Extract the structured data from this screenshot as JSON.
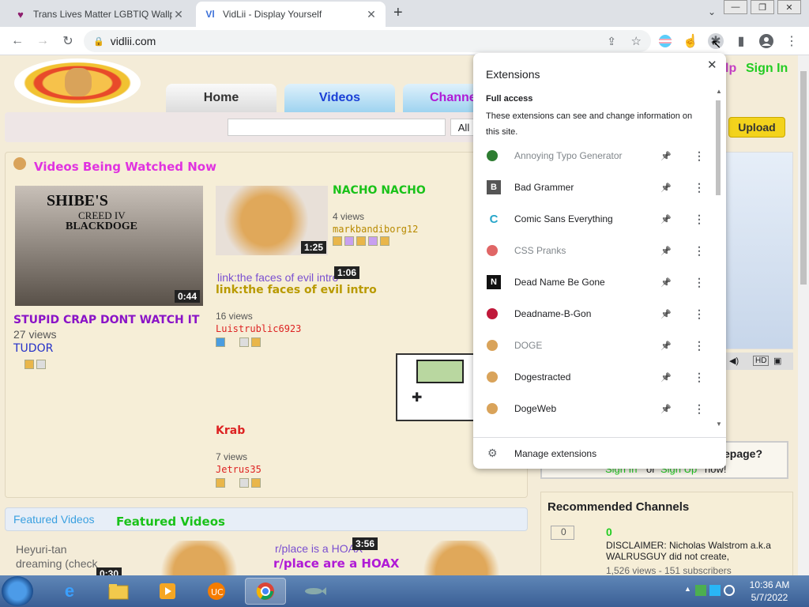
{
  "browser": {
    "tabs": [
      {
        "title": "Trans Lives Matter LGBTIQ Wallpe",
        "icon": "heart-icon",
        "active": false
      },
      {
        "title": "VidLii - Display Yourself",
        "icon": "vidlii-icon",
        "active": true
      }
    ],
    "url": "vidlii.com",
    "new_tab": "+"
  },
  "site": {
    "nav_tabs": [
      "Home",
      "Videos",
      "Channe"
    ],
    "search_scope": "All",
    "top_links": {
      "help_partial": "lp",
      "sign_in": "Sign In"
    },
    "upload_label": "Upload",
    "being_watched_title": "Videos Being Watched Now",
    "videos": [
      {
        "title": "STUPID CRAP DONT WATCH IT",
        "views": "27 views",
        "user": "TUDOR",
        "duration": "0:44",
        "thumb_text_1": "SHIBE'S",
        "thumb_text_2": "CREED IV",
        "thumb_text_3": "BLACKDOGE"
      },
      {
        "title": "NACHO NACHO",
        "views": "4 views",
        "user": "markbandiborg12",
        "duration": "1:25"
      },
      {
        "title": "link:the faces of evil intro",
        "alt": "link:the faces of evil intro",
        "views": "16 views",
        "user": "Luistrublic6923",
        "duration": "1:06"
      },
      {
        "title": "Krab",
        "views": "7 views",
        "user": "Jetrus35"
      }
    ],
    "featured_title": "Featured Videos",
    "featured_alt": "Featured Videos",
    "featured": [
      {
        "title": "Heyuri-tan dreaming (check",
        "duration": "0:30"
      },
      {
        "title": "r/place are a HOAX",
        "alt": "r/place is a HOAX",
        "duration": "3:56"
      }
    ],
    "homepage_box": {
      "q": "epage?",
      "sign_in": "Sign In",
      "or": "or",
      "sign_up": "Sign Up",
      "now": "now!"
    },
    "recommended_title": "Recommended Channels",
    "recommended": [
      {
        "name": "0",
        "alt": "0",
        "desc": "DISCLAIMER: Nicholas Walstrom a.k.a WALRUSGUY did not create,",
        "stats": "1,526 views - 151 subscribers"
      }
    ]
  },
  "extensions_popup": {
    "title": "Extensions",
    "full_access": "Full access",
    "full_access_desc": "These extensions can see and change information on this site.",
    "items": [
      {
        "name": "Annoying Typo Generator",
        "icon": "typo-icon",
        "color": "#2e7d32",
        "glyph": "",
        "muted": true
      },
      {
        "name": "Bad Grammer",
        "icon": "b-icon",
        "color": "#555555",
        "glyph": "B",
        "muted": false
      },
      {
        "name": "Comic Sans Everything",
        "icon": "c-icon",
        "color": "#26a5c9",
        "glyph": "C",
        "muted": false
      },
      {
        "name": "CSS Pranks",
        "icon": "css-pranks-icon",
        "color": "#e06666",
        "glyph": "",
        "muted": true
      },
      {
        "name": "Dead Name Be Gone",
        "icon": "n-icon",
        "color": "#111111",
        "glyph": "N",
        "muted": false
      },
      {
        "name": "Deadname-B-Gon",
        "icon": "skull-icon",
        "color": "#c0183a",
        "glyph": "",
        "muted": false
      },
      {
        "name": "DOGE",
        "icon": "doge-icon",
        "color": "#d9a35a",
        "glyph": "",
        "muted": true
      },
      {
        "name": "Dogestracted",
        "icon": "doge-icon",
        "color": "#d9a35a",
        "glyph": "",
        "muted": false
      },
      {
        "name": "DogeWeb",
        "icon": "doge-icon",
        "color": "#d9a35a",
        "glyph": "",
        "muted": false
      }
    ],
    "manage": "Manage extensions"
  },
  "taskbar": {
    "time": "10:36 AM",
    "date": "5/7/2022"
  }
}
